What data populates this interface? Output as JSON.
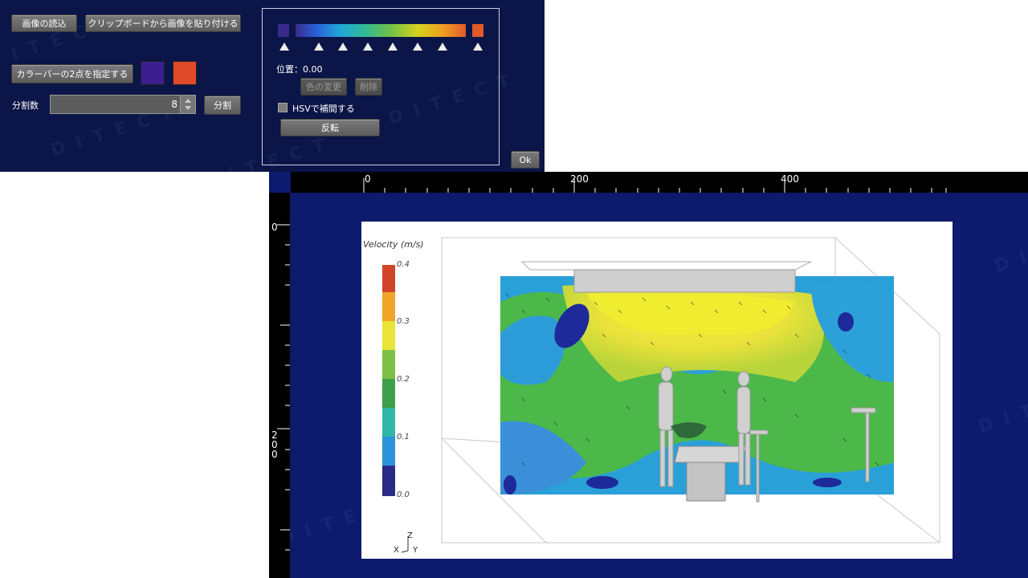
{
  "toolbar": {
    "load_image": "画像の読込",
    "paste_clipboard": "クリップボードから画像を貼り付ける",
    "specify_two_points": "カラーバーの2点を指定する",
    "divisions_label": "分割数",
    "divisions_value": "8",
    "split_button": "分割"
  },
  "swatches": {
    "left_color": "#3b1f8f",
    "right_color": "#e04a2a"
  },
  "colorbar_editor": {
    "position_label": "位置：0.00",
    "change_color": "色の変更",
    "delete": "削除",
    "hsv_label": "HSVで補間する",
    "reverse": "反転",
    "ok": "Ok",
    "bar_start_color": "#3a2a8c",
    "bar_end_color": "#e05a2a"
  },
  "viewer": {
    "ruler_top_labels": [
      "0",
      "200",
      "400"
    ],
    "ruler_left_labels": [
      "0",
      "200"
    ],
    "legend": {
      "title": "Velocity (m/s)",
      "ticks": [
        "0.4",
        "0.3",
        "0.2",
        "0.1",
        "0.0"
      ]
    },
    "axes_labels": {
      "z": "Z",
      "x": "X",
      "y": "Y"
    }
  }
}
